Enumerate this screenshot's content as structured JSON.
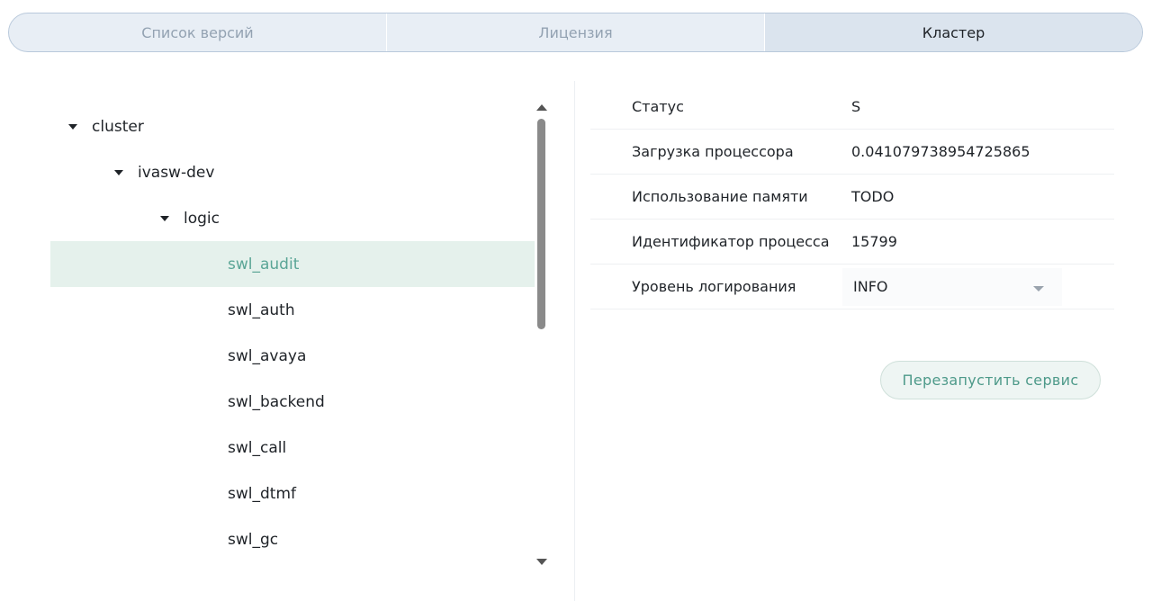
{
  "tabs": [
    {
      "label": "Список версий",
      "active": false
    },
    {
      "label": "Лицензия",
      "active": false
    },
    {
      "label": "Кластер",
      "active": true
    }
  ],
  "tree": {
    "nodes": [
      {
        "label": "cluster",
        "level": 0,
        "expanded": true
      },
      {
        "label": "ivasw-dev",
        "level": 1,
        "expanded": true
      },
      {
        "label": "logic",
        "level": 2,
        "expanded": true
      },
      {
        "label": "swl_audit",
        "level": 3,
        "selected": true
      },
      {
        "label": "swl_auth",
        "level": 3
      },
      {
        "label": "swl_avaya",
        "level": 3
      },
      {
        "label": "swl_backend",
        "level": 3
      },
      {
        "label": "swl_call",
        "level": 3
      },
      {
        "label": "swl_dtmf",
        "level": 3
      },
      {
        "label": "swl_gc",
        "level": 3
      }
    ]
  },
  "details": {
    "status": {
      "label": "Статус",
      "value": "S"
    },
    "cpu": {
      "label": "Загрузка процессора",
      "value": "0.041079738954725865"
    },
    "memory": {
      "label": "Использование памяти",
      "value": "TODO"
    },
    "pid": {
      "label": "Идентификатор процесса",
      "value": "15799"
    },
    "log_level": {
      "label": "Уровень логирования",
      "value": "INFO"
    }
  },
  "actions": {
    "restart_label": "Перезапустить сервис"
  },
  "colors": {
    "accent": "#5aa596",
    "selected_bg": "#e5f1ec",
    "tab_bg": "#e8eef5",
    "tab_active_bg": "#dbe4ee"
  }
}
